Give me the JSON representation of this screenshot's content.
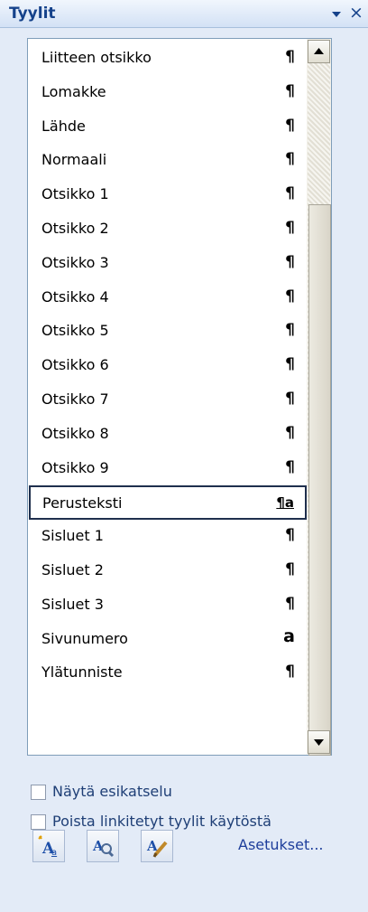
{
  "pane": {
    "title": "Tyylit",
    "menu_icon": "dropdown-triangle-icon",
    "close_icon": "close-x-icon"
  },
  "styles": [
    {
      "name": "Liitteen otsikko",
      "type": "¶"
    },
    {
      "name": "Lomakke",
      "type": "¶"
    },
    {
      "name": "Lähde",
      "type": "¶"
    },
    {
      "name": "Normaali",
      "type": "¶"
    },
    {
      "name": "Otsikko 1",
      "type": "¶"
    },
    {
      "name": "Otsikko 2",
      "type": "¶"
    },
    {
      "name": "Otsikko 3",
      "type": "¶"
    },
    {
      "name": "Otsikko 4",
      "type": "¶"
    },
    {
      "name": "Otsikko 5",
      "type": "¶"
    },
    {
      "name": "Otsikko 6",
      "type": "¶"
    },
    {
      "name": "Otsikko 7",
      "type": "¶"
    },
    {
      "name": "Otsikko 8",
      "type": "¶"
    },
    {
      "name": "Otsikko 9",
      "type": "¶"
    },
    {
      "name": "Perusteksti",
      "type": "¶a"
    },
    {
      "name": "Sisluet 1",
      "type": "¶"
    },
    {
      "name": "Sisluet 2",
      "type": "¶"
    },
    {
      "name": "Sisluet 3",
      "type": "¶"
    },
    {
      "name": "Sivunumero",
      "type": "a"
    },
    {
      "name": "Ylätunniste",
      "type": "¶"
    }
  ],
  "selected_style": "Perusteksti",
  "options": {
    "show_preview": {
      "label": "Näytä esikatselu",
      "checked": false
    },
    "disable_linked": {
      "label": "Poista linkitetyt tyylit käytöstä",
      "checked": false
    }
  },
  "toolbar": {
    "new_style_icon": "new-style-icon",
    "style_inspector_icon": "style-inspector-icon",
    "manage_styles_icon": "manage-styles-icon",
    "options_link": "Asetukset..."
  },
  "colors": {
    "title_text": "#15428b",
    "link_text": "#1e3e9b",
    "pane_background": "#e3ebf7",
    "selection_border": "#1f2f4d"
  }
}
